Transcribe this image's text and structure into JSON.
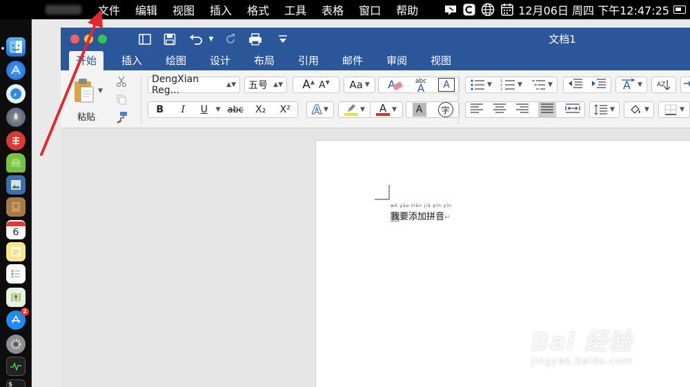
{
  "menubar": {
    "apple": "",
    "menus": [
      "文件",
      "编辑",
      "视图",
      "插入",
      "格式",
      "工具",
      "表格",
      "窗口",
      "帮助"
    ],
    "clock": "12月06日 周四 下午12:47:25"
  },
  "window": {
    "title": "文档1",
    "tabs": [
      "开始",
      "插入",
      "绘图",
      "设计",
      "布局",
      "引用",
      "邮件",
      "审阅",
      "视图"
    ],
    "active_tab": "开始"
  },
  "ribbon": {
    "paste_label": "粘贴",
    "font_name": "DengXian Reg...",
    "font_size": "五号",
    "grow_font": "A",
    "shrink_font": "A",
    "change_case": "Aa",
    "phonetic_guide": "abc",
    "char_border": "A",
    "bold": "B",
    "italic": "I",
    "underline": "U",
    "strikethrough": "abc",
    "subscript": "X₂",
    "superscript": "X²",
    "text_effects": "A",
    "font_color": "A",
    "char_shading": "A",
    "enclose_char": "字",
    "sort": "AZ"
  },
  "document": {
    "pinyin": "wǒ yào tiān jiā pīn yīn",
    "text_selected": "我",
    "text_rest": "要添加拼音",
    "para_mark": "↵"
  },
  "watermark": {
    "main": "Bai 经验",
    "url": "jingyan.baidu.com"
  },
  "colors": {
    "word_blue": "#2b579a",
    "arrow_red": "#e0282e",
    "font_color_bar": "#e0282e",
    "highlight_bar": "#f5e200"
  }
}
